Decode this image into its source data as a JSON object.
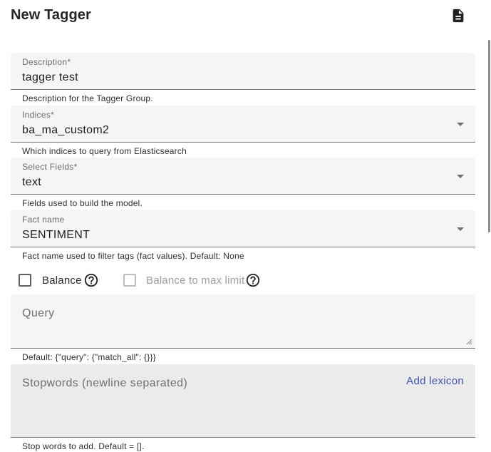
{
  "header": {
    "title": "New Tagger",
    "doc_icon": "document-icon"
  },
  "form": {
    "description": {
      "label": "Description*",
      "value": "tagger test",
      "hint": "Description for the Tagger Group."
    },
    "indices": {
      "label": "Indices*",
      "value": "ba_ma_custom2",
      "hint": "Which indices to query from Elasticsearch"
    },
    "fields": {
      "label": "Select Fields*",
      "value": "text",
      "hint": "Fields used to build the model."
    },
    "fact_name": {
      "label": "Fact name",
      "value": "SENTIMENT",
      "hint": "Fact name used to filter tags (fact values). Default: None"
    },
    "balance": {
      "label": "Balance",
      "checked": false
    },
    "balance_max": {
      "label": "Balance to max limit",
      "checked": false,
      "disabled": true
    },
    "query": {
      "placeholder": "Query",
      "hint": "Default: {\"query\": {\"match_all\": {}}}"
    },
    "stopwords": {
      "placeholder": "Stopwords (newline separated)",
      "action": "Add lexicon",
      "hint": "Stop words to add. Default = []."
    }
  },
  "colors": {
    "accent": "#3f51b5",
    "field_bg": "#f5f5f5",
    "disabled_field_bg": "#ebebeb"
  }
}
